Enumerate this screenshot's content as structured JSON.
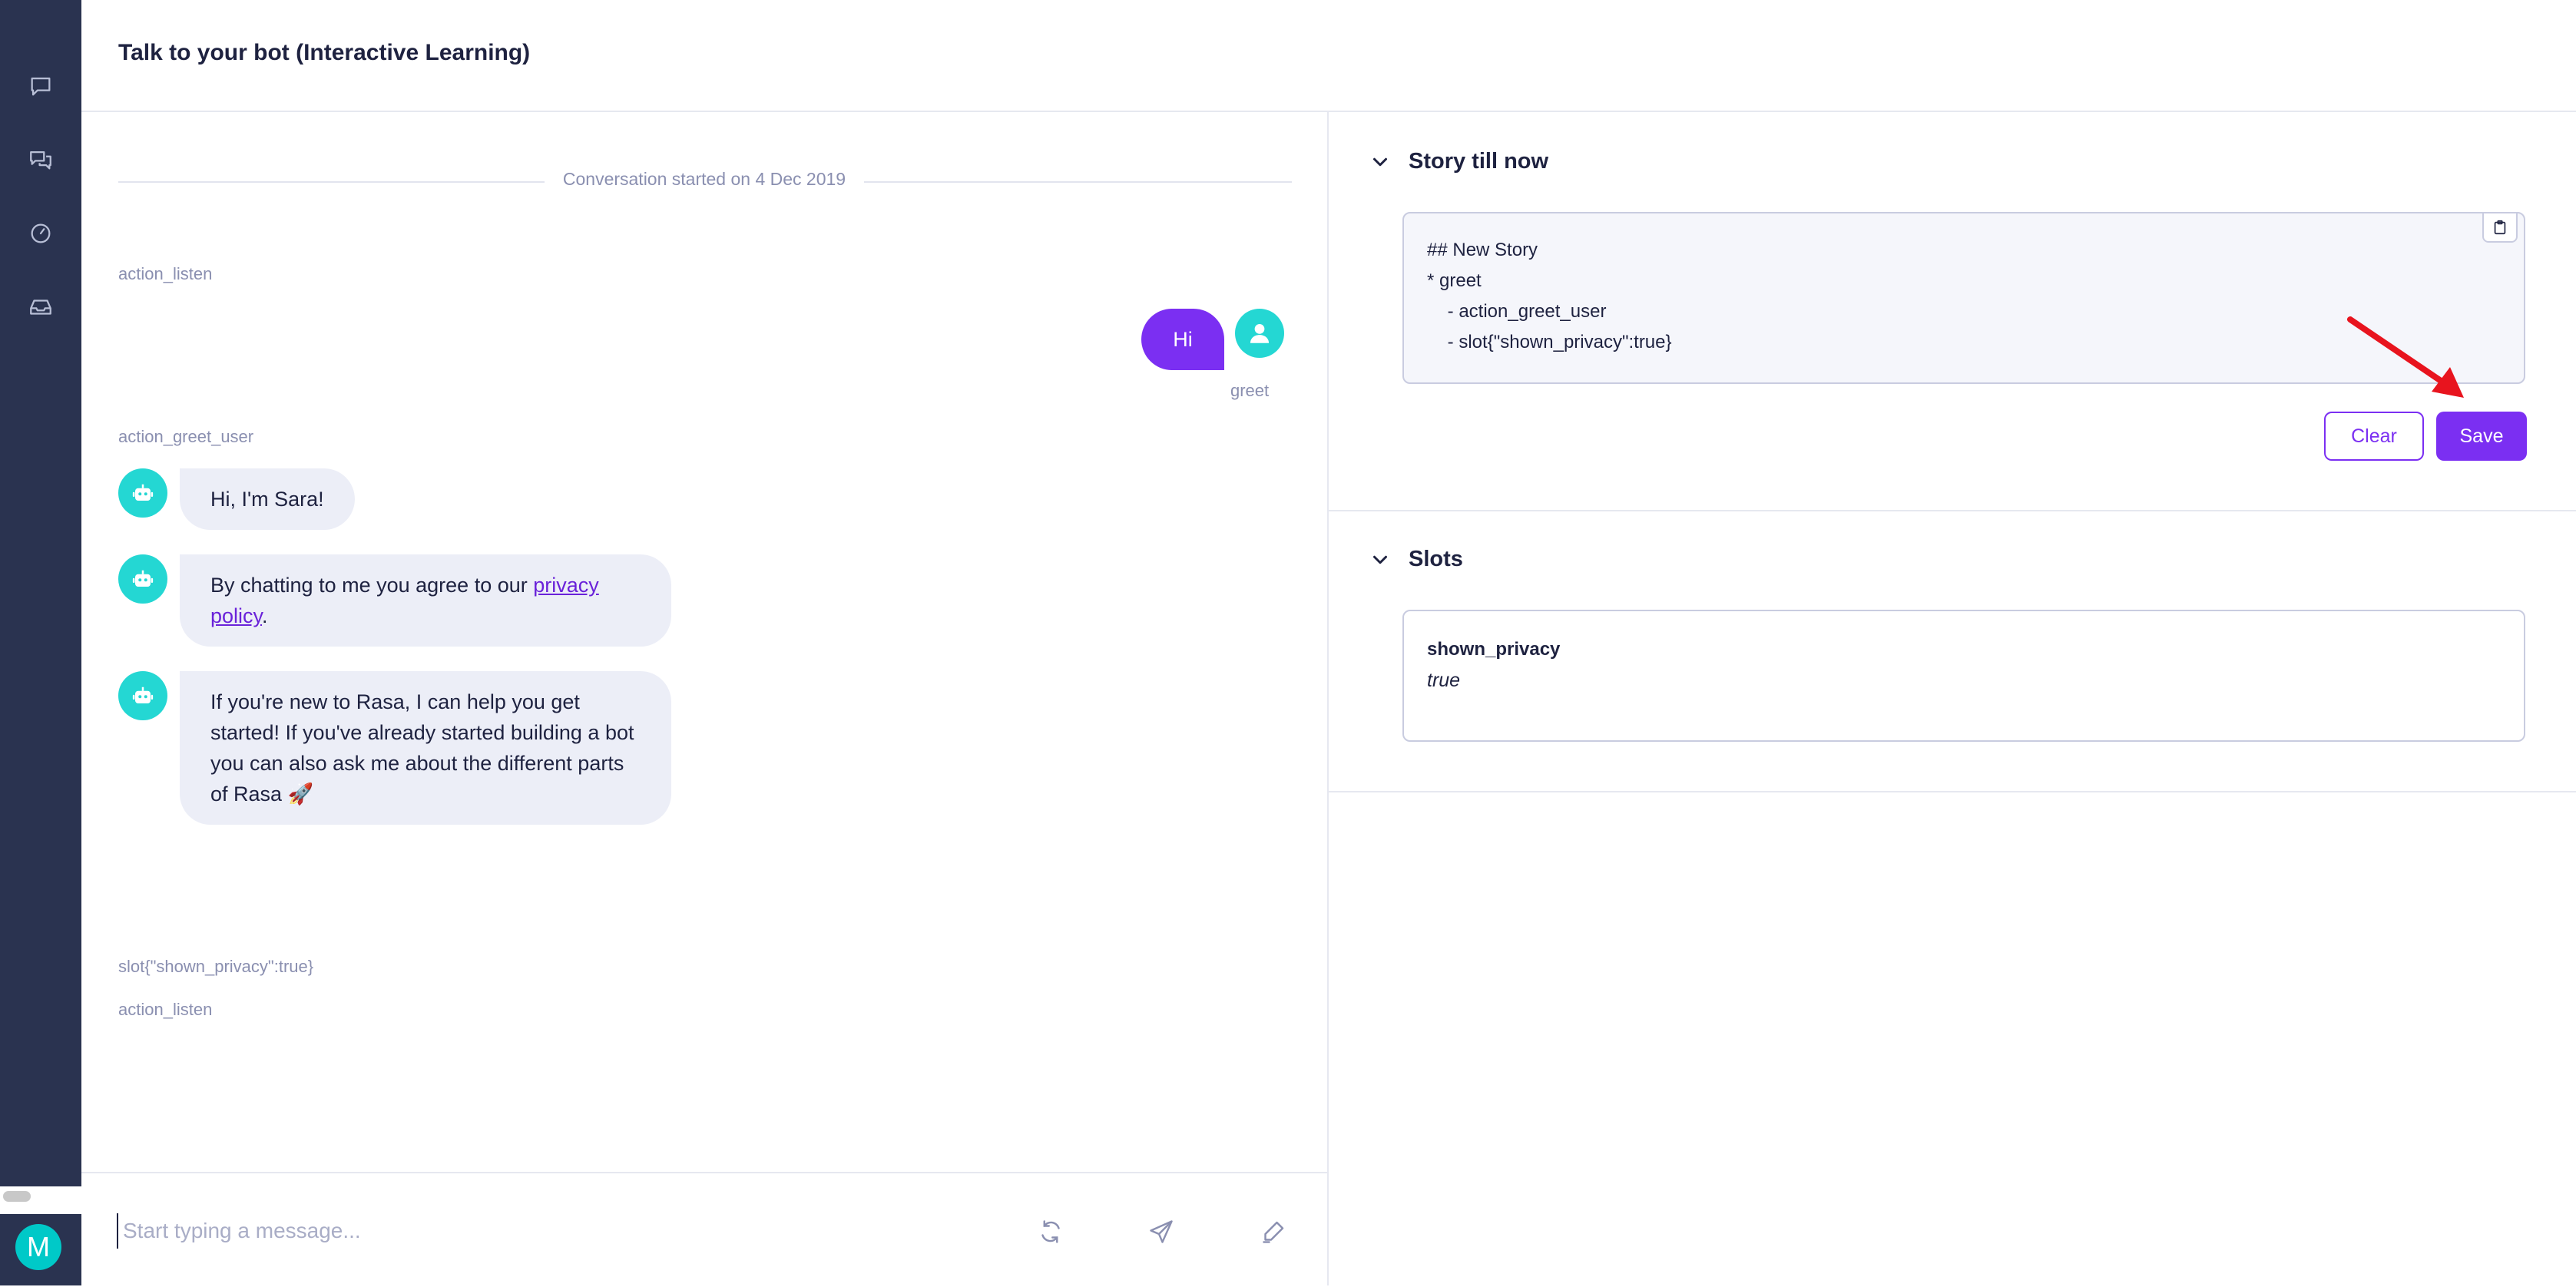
{
  "header": {
    "title": "Talk to your bot (Interactive Learning)"
  },
  "sidebar": {
    "items": [
      {
        "icon": "chat-bubble-icon"
      },
      {
        "icon": "conversations-icon"
      },
      {
        "icon": "dashboard-gauge-icon"
      },
      {
        "icon": "inbox-icon"
      }
    ],
    "user_initial": "M"
  },
  "chat": {
    "started_text": "Conversation started on 4 Dec 2019",
    "events": {
      "action_listen_1": "action_listen",
      "user_message": "Hi",
      "user_intent": "greet",
      "action_greet_user": "action_greet_user",
      "bot_msg_1": "Hi, I'm Sara!",
      "bot_msg_2_text": "By chatting to me you agree to our ",
      "bot_msg_2_link": "privacy policy",
      "bot_msg_2_end": ".",
      "bot_msg_3": "If you're new to Rasa, I can help you get started! If you've already started building a bot you can also ask me about the different parts of Rasa 🚀",
      "slot_event": "slot{\"shown_privacy\":true}",
      "action_listen_2": "action_listen"
    },
    "composer": {
      "placeholder": "Start typing a message..."
    }
  },
  "story": {
    "title": "Story till now",
    "lines": [
      "## New Story",
      "* greet",
      "    - action_greet_user",
      "    - slot{\"shown_privacy\":true}"
    ],
    "clear_label": "Clear",
    "save_label": "Save"
  },
  "slots": {
    "title": "Slots",
    "items": [
      {
        "name": "shown_privacy",
        "value": "true"
      }
    ]
  },
  "colors": {
    "accent": "#7b2ff2",
    "avatar": "#24d7d3",
    "sidebar": "#2a3350",
    "annotation": "#e8141e"
  }
}
